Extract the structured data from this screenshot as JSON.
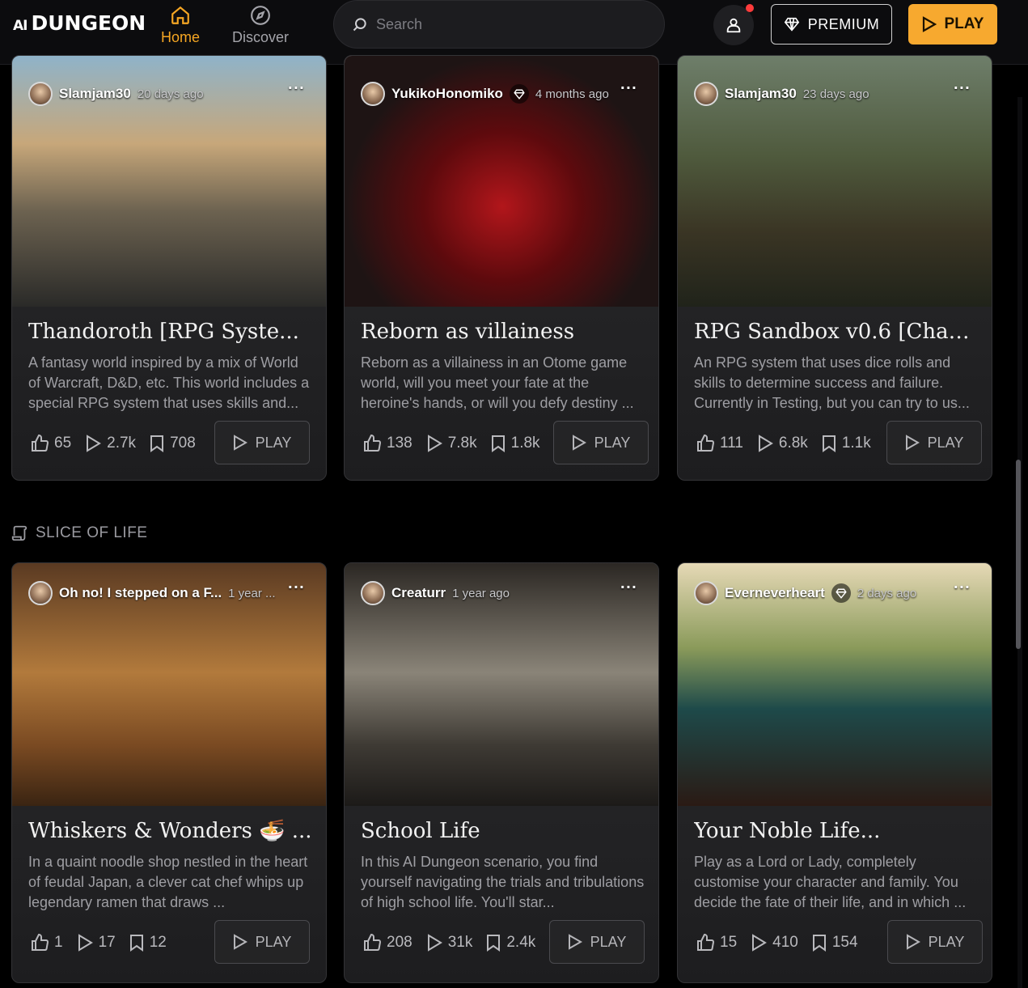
{
  "nav": {
    "logo_ai": "AI",
    "logo_name": "DUNGEON",
    "tabs": [
      {
        "label": "Home",
        "icon": "home-icon",
        "active": true
      },
      {
        "label": "Discover",
        "icon": "compass-icon",
        "active": false
      }
    ],
    "search_placeholder": "Search",
    "premium_label": "PREMIUM",
    "play_label": "PLAY",
    "accent_color": "#f7a92f"
  },
  "section": {
    "label": "SLICE OF LIFE",
    "icon": "scroll-icon"
  },
  "cards": [
    {
      "author": "Slamjam30",
      "posted": "20 days ago",
      "verified": false,
      "title": "Thandoroth [RPG Syste...",
      "description": "A fantasy world inspired by a mix of World of Warcraft, D&D, etc. This world includes a special RPG system that uses skills and...",
      "likes": "65",
      "plays": "2.7k",
      "saves": "708",
      "play_label": "PLAY"
    },
    {
      "author": "YukikoHonomiko",
      "posted": "4 months ago",
      "verified": true,
      "title": "Reborn as villainess",
      "description": "Reborn as a villainess in an Otome game world, will you meet your fate at the heroine's hands, or will you defy destiny ...",
      "likes": "138",
      "plays": "7.8k",
      "saves": "1.8k",
      "play_label": "PLAY"
    },
    {
      "author": "Slamjam30",
      "posted": "23 days ago",
      "verified": false,
      "title": "RPG Sandbox v0.6 [Chap...",
      "description": "An RPG system that uses dice rolls and skills to determine success and failure. Currently in Testing, but you can try to us...",
      "likes": "111",
      "plays": "6.8k",
      "saves": "1.1k",
      "play_label": "PLAY"
    },
    {
      "author": "Oh no! I stepped on a F...",
      "posted": "1 year ...",
      "verified": false,
      "title": "Whiskers & Wonders 🍜 ...",
      "description": "In a quaint noodle shop nestled in the heart of feudal Japan, a clever cat chef whips up legendary ramen that draws ...",
      "likes": "1",
      "plays": "17",
      "saves": "12",
      "play_label": "PLAY"
    },
    {
      "author": "Creaturr",
      "posted": "1 year ago",
      "verified": false,
      "title": "School Life",
      "description": "In this AI Dungeon scenario, you find yourself navigating the trials and tribulations of high school life. You'll star...",
      "likes": "208",
      "plays": "31k",
      "saves": "2.4k",
      "play_label": "PLAY"
    },
    {
      "author": "Everneverheart",
      "posted": "2 days ago",
      "verified": true,
      "title": "Your Noble Life...",
      "description": "Play as a Lord or Lady, completely customise your character and family. You decide the fate of their life, and in which ...",
      "likes": "15",
      "plays": "410",
      "saves": "154",
      "play_label": "PLAY"
    }
  ]
}
